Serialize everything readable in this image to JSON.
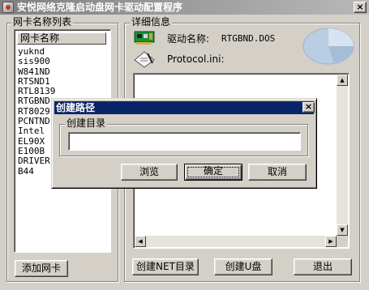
{
  "window": {
    "title": "安悦网络克隆启动盘网卡驱动配置程序",
    "close_glyph": "×"
  },
  "nic_list": {
    "group_label": "网卡名称列表",
    "column_header": "网卡名称",
    "items": [
      "yuknd",
      "sis900",
      "W841ND",
      "RTSND1",
      "RTL8139",
      "RTGBND",
      "RT8029",
      "PCNTND",
      "Intel",
      "EL90X",
      "E100B",
      "DRIVER",
      "B44"
    ],
    "add_button": "添加网卡"
  },
  "details": {
    "group_label": "详细信息",
    "driver_label": "驱动名称:",
    "driver_value": "RTGBND.DOS",
    "protocol_label": "Protocol.ini:",
    "buttons": {
      "create_net_dir": "创建NET目录",
      "create_udisk": "创建U盘",
      "exit": "退出"
    }
  },
  "dialog": {
    "title": "创建路径",
    "close_glyph": "×",
    "group_label": "创建目录",
    "path_value": "",
    "buttons": {
      "browse": "浏览",
      "ok": "确定",
      "cancel": "取消"
    }
  }
}
